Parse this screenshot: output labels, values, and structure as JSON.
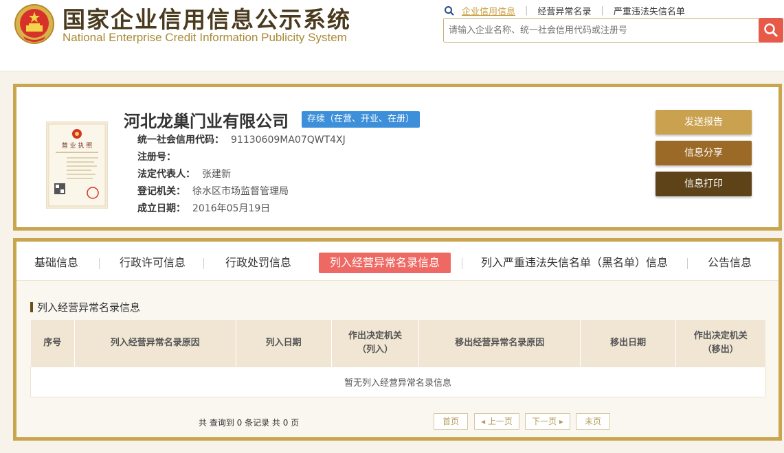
{
  "header": {
    "title_cn": "国家企业信用信息公示系统",
    "title_en": "National Enterprise Credit Information Publicity System",
    "nav": [
      "企业信用信息",
      "经营异常名录",
      "严重违法失信名单"
    ],
    "search_placeholder": "请输入企业名称、统一社会信用代码或注册号"
  },
  "company": {
    "name": "河北龙巢门业有限公司",
    "status": "存续（在营、开业、在册）",
    "fields": [
      {
        "label": "统一社会信用代码：",
        "value": "91130609MA07QWT4XJ"
      },
      {
        "label": "注册号：",
        "value": ""
      },
      {
        "label": "法定代表人：",
        "value": "张建新"
      },
      {
        "label": "登记机关：",
        "value": "徐水区市场监督管理局"
      },
      {
        "label": "成立日期：",
        "value": "2016年05月19日"
      }
    ],
    "license_text": "营 业 执 照"
  },
  "actions": {
    "report": "发送报告",
    "share": "信息分享",
    "print": "信息打印"
  },
  "tabs": [
    "基础信息",
    "行政许可信息",
    "行政处罚信息",
    "列入经营异常名录信息",
    "列入严重违法失信名单（黑名单）信息",
    "公告信息"
  ],
  "section": {
    "title": "列入经营异常名录信息",
    "columns": [
      "序号",
      "列入经营异常名录原因",
      "列入日期",
      "作出决定机关（列入）",
      "移出经营异常名录原因",
      "移出日期",
      "作出决定机关（移出）"
    ],
    "empty_text": "暂无列入经营异常名录信息"
  },
  "pager": {
    "info": "共 查询到 0 条记录 共 0 页",
    "first": "首页",
    "prev": "上一页",
    "next": "下一页",
    "last": "末页"
  },
  "colors": {
    "accent_gold": "#c9a54f",
    "active_tab": "#ee6963",
    "status_blue": "#3c8fd8",
    "search_red": "#e75a4a"
  }
}
